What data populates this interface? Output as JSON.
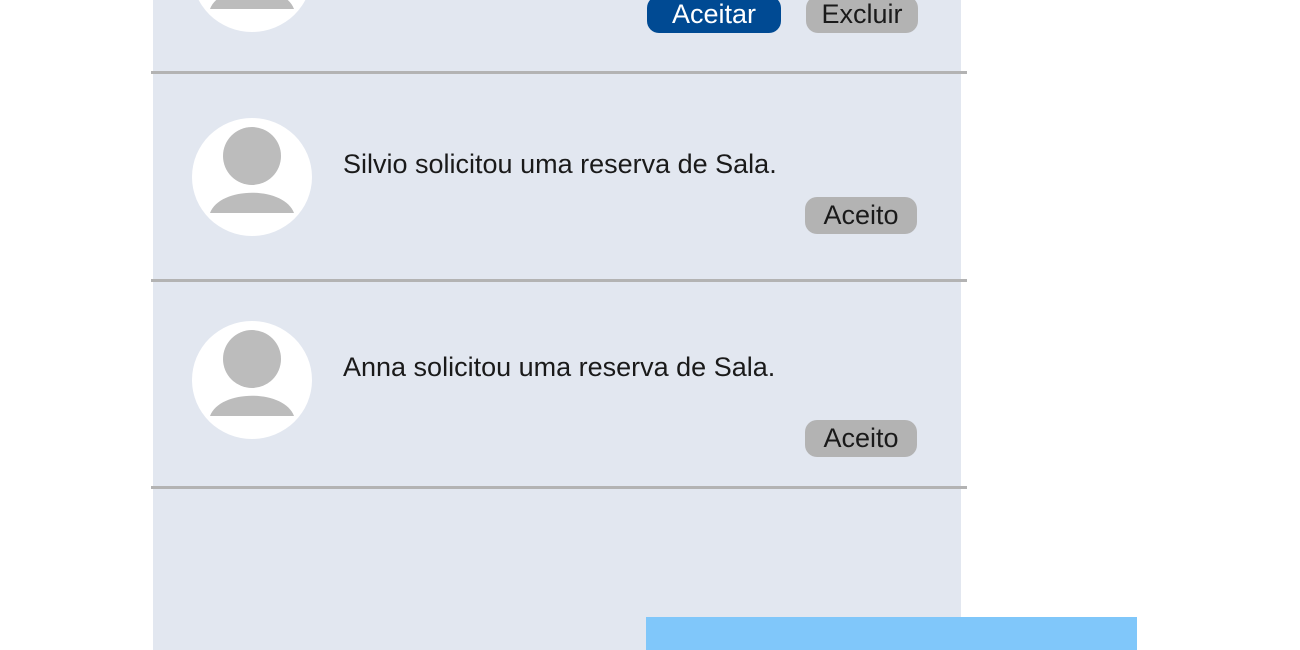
{
  "notifications": [
    {
      "text": "",
      "actions": {
        "accept_label": "Aceitar",
        "delete_label": "Excluir"
      }
    },
    {
      "text": "Silvio solicitou uma reserva de Sala.",
      "status_label": "Aceito"
    },
    {
      "text": "Anna solicitou uma reserva de Sala.",
      "status_label": "Aceito"
    }
  ],
  "icons": {
    "avatar": "user-avatar-icon"
  },
  "colors": {
    "panel_background": "#e2e7f0",
    "divider": "#b3b3b3",
    "primary_button": "#004a93",
    "secondary_button": "#b3b3b3",
    "avatar_silhouette": "#bcbcbc",
    "bottom_bar": "#80c7fa"
  }
}
